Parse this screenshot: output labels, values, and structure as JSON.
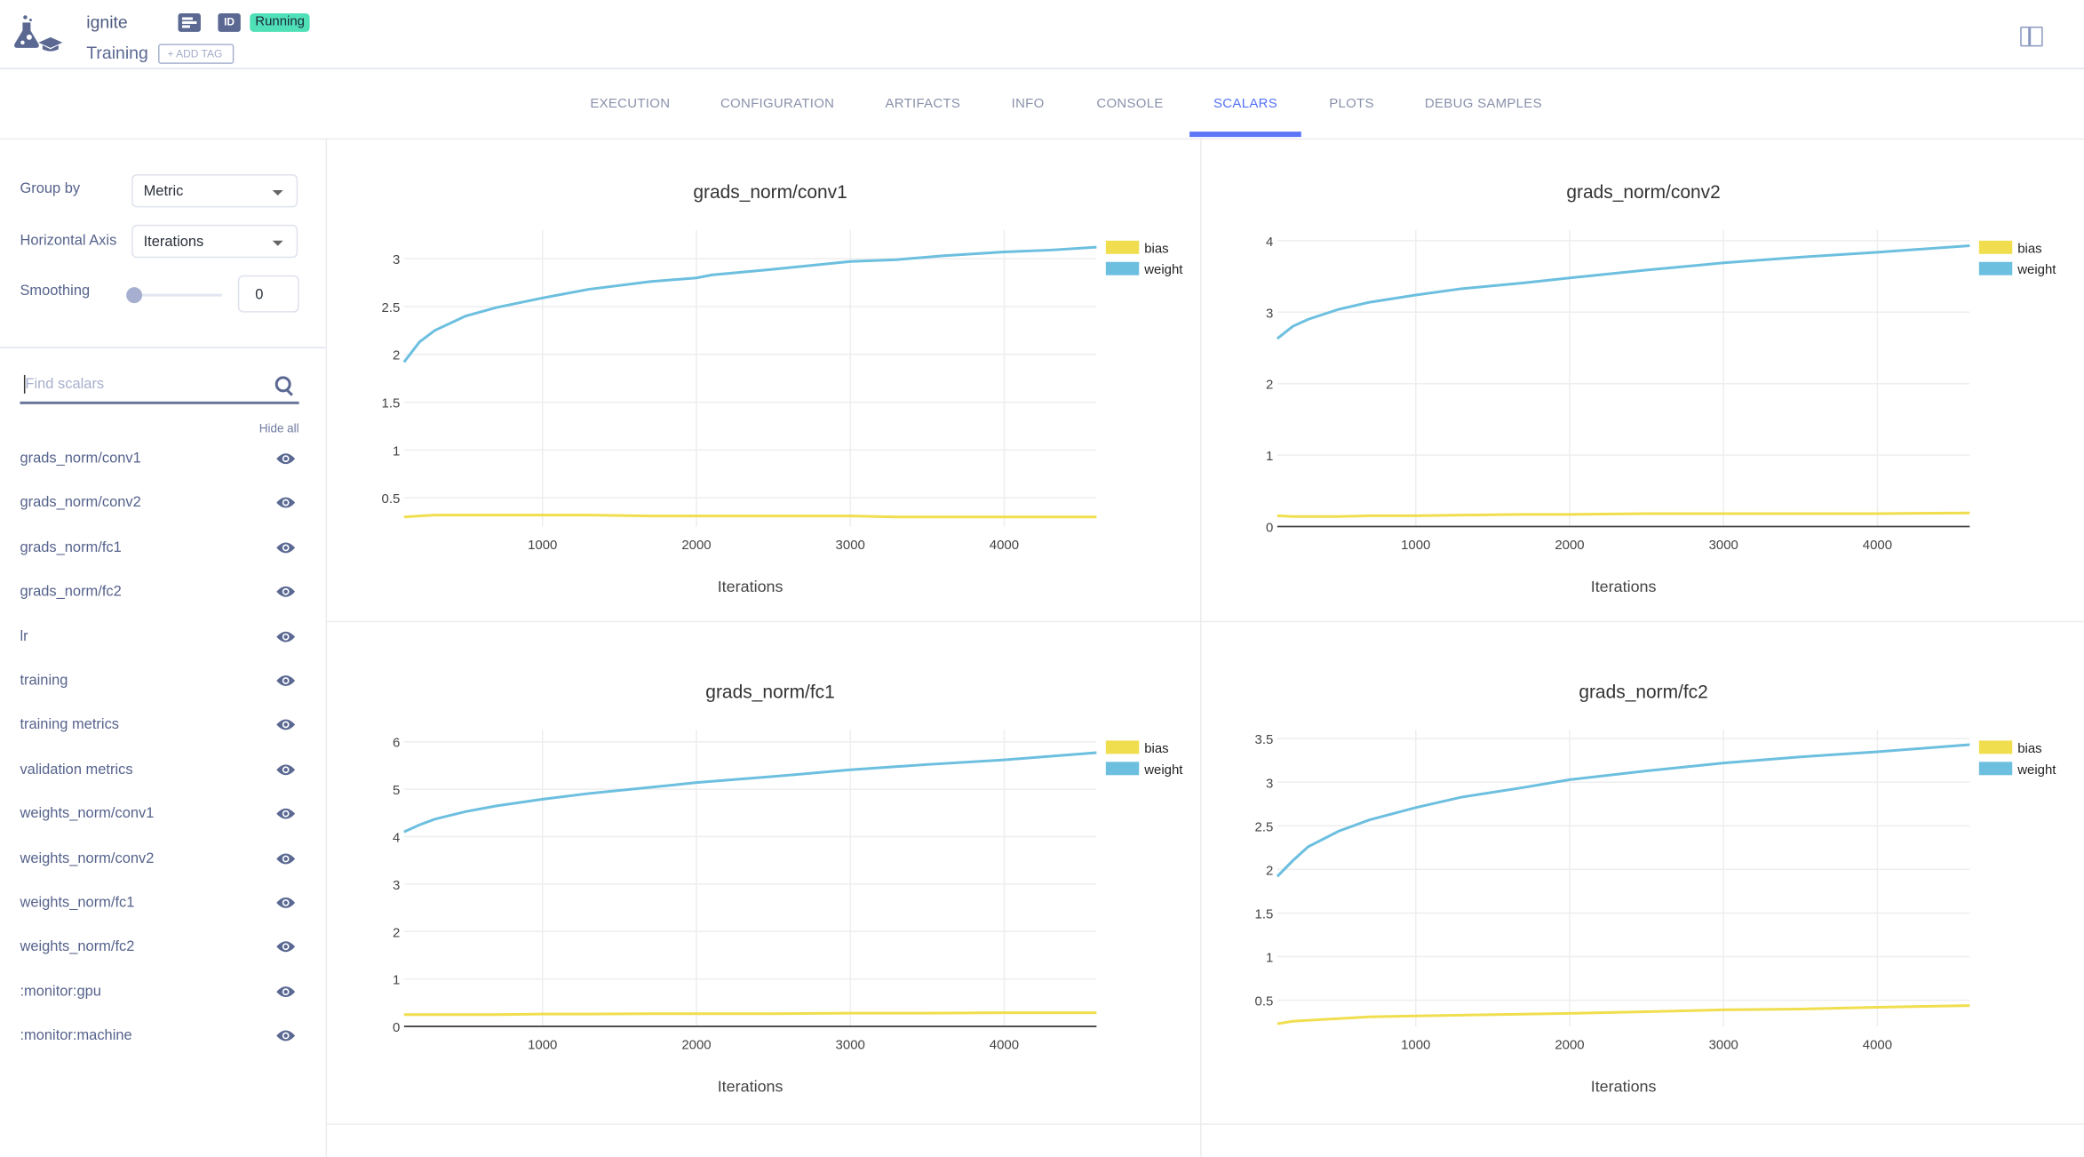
{
  "header": {
    "project": "ignite",
    "task_name": "Training",
    "status": "Running",
    "id_label": "ID",
    "add_tag": "+ ADD TAG",
    "colors": {
      "status": "#4fe0b8",
      "icon": "#5a6892"
    }
  },
  "tabs": [
    {
      "label": "EXECUTION",
      "active": false
    },
    {
      "label": "CONFIGURATION",
      "active": false
    },
    {
      "label": "ARTIFACTS",
      "active": false
    },
    {
      "label": "INFO",
      "active": false
    },
    {
      "label": "CONSOLE",
      "active": false
    },
    {
      "label": "SCALARS",
      "active": true
    },
    {
      "label": "PLOTS",
      "active": false
    },
    {
      "label": "DEBUG SAMPLES",
      "active": false
    }
  ],
  "sidebar": {
    "group_by_label": "Group by",
    "group_by_value": "Metric",
    "horizontal_axis_label": "Horizontal Axis",
    "horizontal_axis_value": "Iterations",
    "smoothing_label": "Smoothing",
    "smoothing_value": "0",
    "search_placeholder": "Find scalars",
    "hide_all": "Hide all",
    "items": [
      "grads_norm/conv1",
      "grads_norm/conv2",
      "grads_norm/fc1",
      "grads_norm/fc2",
      "lr",
      "training",
      "training metrics",
      "validation metrics",
      "weights_norm/conv1",
      "weights_norm/conv2",
      "weights_norm/fc1",
      "weights_norm/fc2",
      ":monitor:gpu",
      ":monitor:machine"
    ]
  },
  "chart_data": [
    {
      "type": "line",
      "title": "grads_norm/conv1",
      "xlabel": "Iterations",
      "ylabel": "",
      "xlim": [
        100,
        4600
      ],
      "ylim": [
        0.2,
        3.3
      ],
      "xticks": [
        1000,
        2000,
        3000,
        4000
      ],
      "yticks": [
        0.5,
        1,
        1.5,
        2,
        2.5,
        3
      ],
      "ytick_labels": [
        "0.5",
        "1",
        "1.5",
        "2",
        "2.5",
        "3"
      ],
      "legend": "top-right",
      "grid": true,
      "zero_line": false,
      "x": [
        100,
        200,
        300,
        500,
        700,
        1000,
        1300,
        1700,
        2000,
        2100,
        2500,
        3000,
        3300,
        3600,
        4000,
        4300,
        4600
      ],
      "series": [
        {
          "name": "bias",
          "color": "#f0de4e",
          "values": [
            0.3,
            0.31,
            0.32,
            0.32,
            0.32,
            0.32,
            0.32,
            0.31,
            0.31,
            0.31,
            0.31,
            0.31,
            0.3,
            0.3,
            0.3,
            0.3,
            0.3
          ]
        },
        {
          "name": "weight",
          "color": "#6cbfdf",
          "values": [
            1.92,
            2.13,
            2.25,
            2.4,
            2.49,
            2.59,
            2.68,
            2.76,
            2.8,
            2.83,
            2.89,
            2.97,
            2.99,
            3.03,
            3.07,
            3.09,
            3.12
          ]
        }
      ]
    },
    {
      "type": "line",
      "title": "grads_norm/conv2",
      "xlabel": "Iterations",
      "ylabel": "",
      "xlim": [
        100,
        4600
      ],
      "ylim": [
        0,
        4.15
      ],
      "xticks": [
        1000,
        2000,
        3000,
        4000
      ],
      "yticks": [
        0,
        1,
        2,
        3,
        4
      ],
      "ytick_labels": [
        "0",
        "1",
        "2",
        "3",
        "4"
      ],
      "legend": "top-right",
      "grid": true,
      "zero_line": true,
      "x": [
        100,
        200,
        300,
        500,
        700,
        1000,
        1300,
        1700,
        2000,
        2500,
        3000,
        3500,
        4000,
        4600
      ],
      "series": [
        {
          "name": "bias",
          "color": "#f0de4e",
          "values": [
            0.15,
            0.14,
            0.14,
            0.14,
            0.15,
            0.15,
            0.16,
            0.17,
            0.17,
            0.18,
            0.18,
            0.18,
            0.18,
            0.19
          ]
        },
        {
          "name": "weight",
          "color": "#6cbfdf",
          "values": [
            2.63,
            2.8,
            2.9,
            3.04,
            3.14,
            3.24,
            3.33,
            3.41,
            3.48,
            3.59,
            3.69,
            3.77,
            3.84,
            3.93
          ]
        }
      ]
    },
    {
      "type": "line",
      "title": "grads_norm/fc1",
      "xlabel": "Iterations",
      "ylabel": "",
      "xlim": [
        100,
        4600
      ],
      "ylim": [
        0,
        6.25
      ],
      "xticks": [
        1000,
        2000,
        3000,
        4000
      ],
      "yticks": [
        0,
        1,
        2,
        3,
        4,
        5,
        6
      ],
      "ytick_labels": [
        "0",
        "1",
        "2",
        "3",
        "4",
        "5",
        "6"
      ],
      "legend": "top-right",
      "grid": true,
      "zero_line": true,
      "x": [
        100,
        200,
        300,
        500,
        700,
        1000,
        1300,
        1700,
        2000,
        2500,
        3000,
        3500,
        4000,
        4600
      ],
      "series": [
        {
          "name": "bias",
          "color": "#f0de4e",
          "values": [
            0.25,
            0.25,
            0.25,
            0.25,
            0.25,
            0.26,
            0.26,
            0.27,
            0.27,
            0.27,
            0.28,
            0.28,
            0.29,
            0.29
          ]
        },
        {
          "name": "weight",
          "color": "#6cbfdf",
          "values": [
            4.1,
            4.25,
            4.37,
            4.53,
            4.65,
            4.79,
            4.91,
            5.04,
            5.14,
            5.27,
            5.41,
            5.52,
            5.62,
            5.77
          ]
        }
      ]
    },
    {
      "type": "line",
      "title": "grads_norm/fc2",
      "xlabel": "Iterations",
      "ylabel": "",
      "xlim": [
        100,
        4600
      ],
      "ylim": [
        0.2,
        3.6
      ],
      "xticks": [
        1000,
        2000,
        3000,
        4000
      ],
      "yticks": [
        0.5,
        1,
        1.5,
        2,
        2.5,
        3,
        3.5
      ],
      "ytick_labels": [
        "0.5",
        "1",
        "1.5",
        "2",
        "2.5",
        "3",
        "3.5"
      ],
      "legend": "top-right",
      "grid": true,
      "zero_line": false,
      "x": [
        100,
        200,
        300,
        500,
        700,
        1000,
        1300,
        1700,
        2000,
        2500,
        3000,
        3500,
        4000,
        4600
      ],
      "series": [
        {
          "name": "bias",
          "color": "#f0de4e",
          "values": [
            0.23,
            0.26,
            0.27,
            0.29,
            0.31,
            0.32,
            0.33,
            0.34,
            0.35,
            0.37,
            0.39,
            0.4,
            0.42,
            0.44
          ]
        },
        {
          "name": "weight",
          "color": "#6cbfdf",
          "values": [
            1.92,
            2.1,
            2.26,
            2.44,
            2.57,
            2.71,
            2.83,
            2.94,
            3.03,
            3.13,
            3.22,
            3.29,
            3.35,
            3.43
          ]
        }
      ]
    }
  ]
}
